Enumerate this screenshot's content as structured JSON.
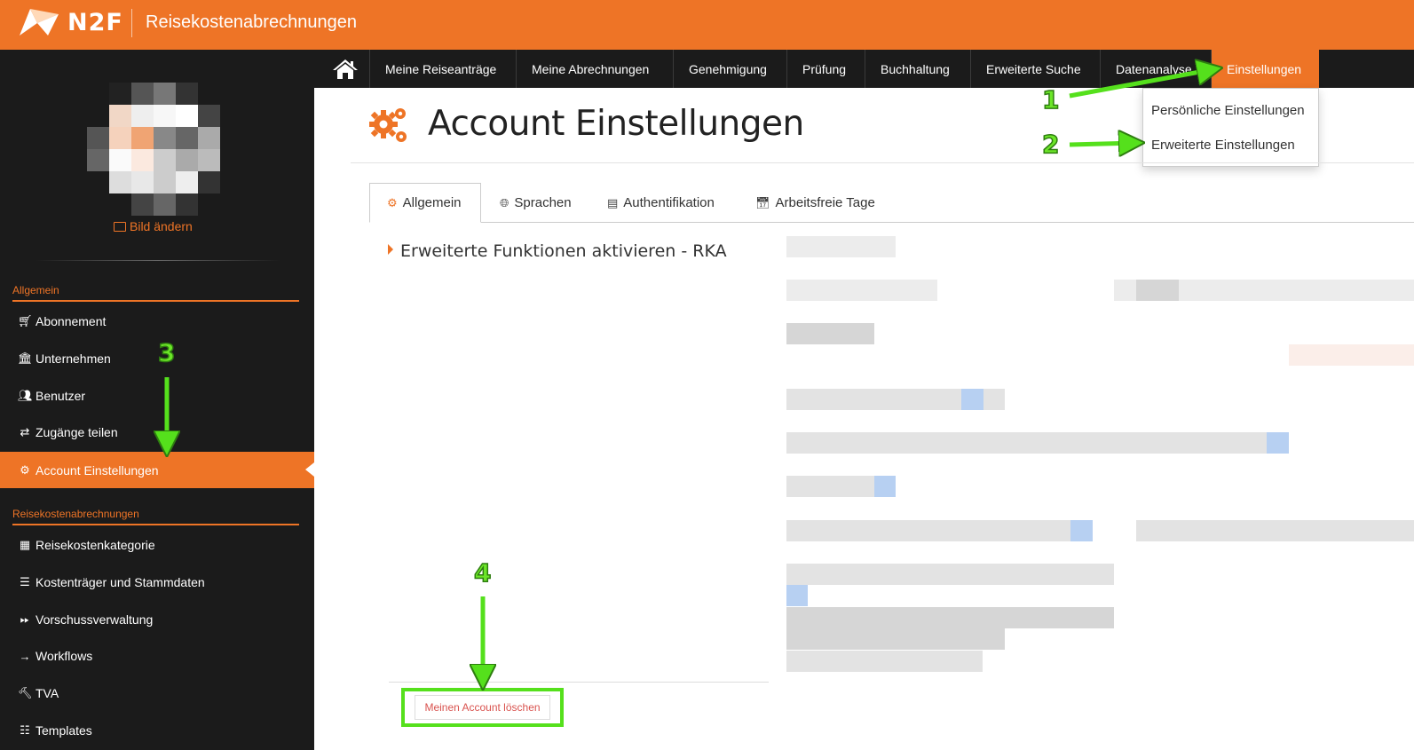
{
  "header": {
    "brand": "N2F",
    "app_title": "Reisekostenabrechnungen"
  },
  "sidebar": {
    "change_picture": "Bild ändern",
    "section_general": "Allgemein",
    "section_travel": "Reisekostenabrechnungen",
    "items": [
      {
        "label": "Abonnement",
        "icon": "cart-icon"
      },
      {
        "label": "Unternehmen",
        "icon": "bank-icon"
      },
      {
        "label": "Benutzer",
        "icon": "users-icon"
      },
      {
        "label": "Zugänge teilen",
        "icon": "handshake-icon"
      },
      {
        "label": "Account Einstellungen",
        "icon": "gears-icon",
        "active": true
      },
      {
        "label": "Reisekostenkategorie",
        "icon": "grid-icon"
      },
      {
        "label": "Kostenträger und Stammdaten",
        "icon": "table-icon"
      },
      {
        "label": "Vorschussverwaltung",
        "icon": "fast-forward-icon"
      },
      {
        "label": "Workflows",
        "icon": "arrow-right-icon"
      },
      {
        "label": "TVA",
        "icon": "gavel-icon"
      },
      {
        "label": "Templates",
        "icon": "list-icon"
      }
    ]
  },
  "nav": {
    "items": [
      {
        "label": "Meine Reiseanträge"
      },
      {
        "label": "Meine Abrechnungen"
      },
      {
        "label": "Genehmigung"
      },
      {
        "label": "Prüfung"
      },
      {
        "label": "Buchhaltung"
      },
      {
        "label": "Erweiterte Suche"
      },
      {
        "label": "Datenanalyse"
      },
      {
        "label": "Einstellungen",
        "active": true
      }
    ]
  },
  "dropdown": {
    "items": [
      {
        "label": "Persönliche Einstellungen"
      },
      {
        "label": "Erweiterte Einstellungen"
      }
    ]
  },
  "page": {
    "title": "Account Einstellungen",
    "tabs": [
      {
        "label": "Allgemein",
        "active": true
      },
      {
        "label": "Sprachen"
      },
      {
        "label": "Authentifikation"
      },
      {
        "label": "Arbeitsfreie Tage"
      }
    ],
    "section_title": "Erweiterte Funktionen aktivieren - RKA",
    "delete_button": "Meinen Account löschen"
  },
  "annotations": [
    "1",
    "2",
    "3",
    "4"
  ],
  "colors": {
    "accent": "#ee7426",
    "dark": "#1b1b1b",
    "annotation": "#55e01c",
    "danger": "#d9534f"
  }
}
